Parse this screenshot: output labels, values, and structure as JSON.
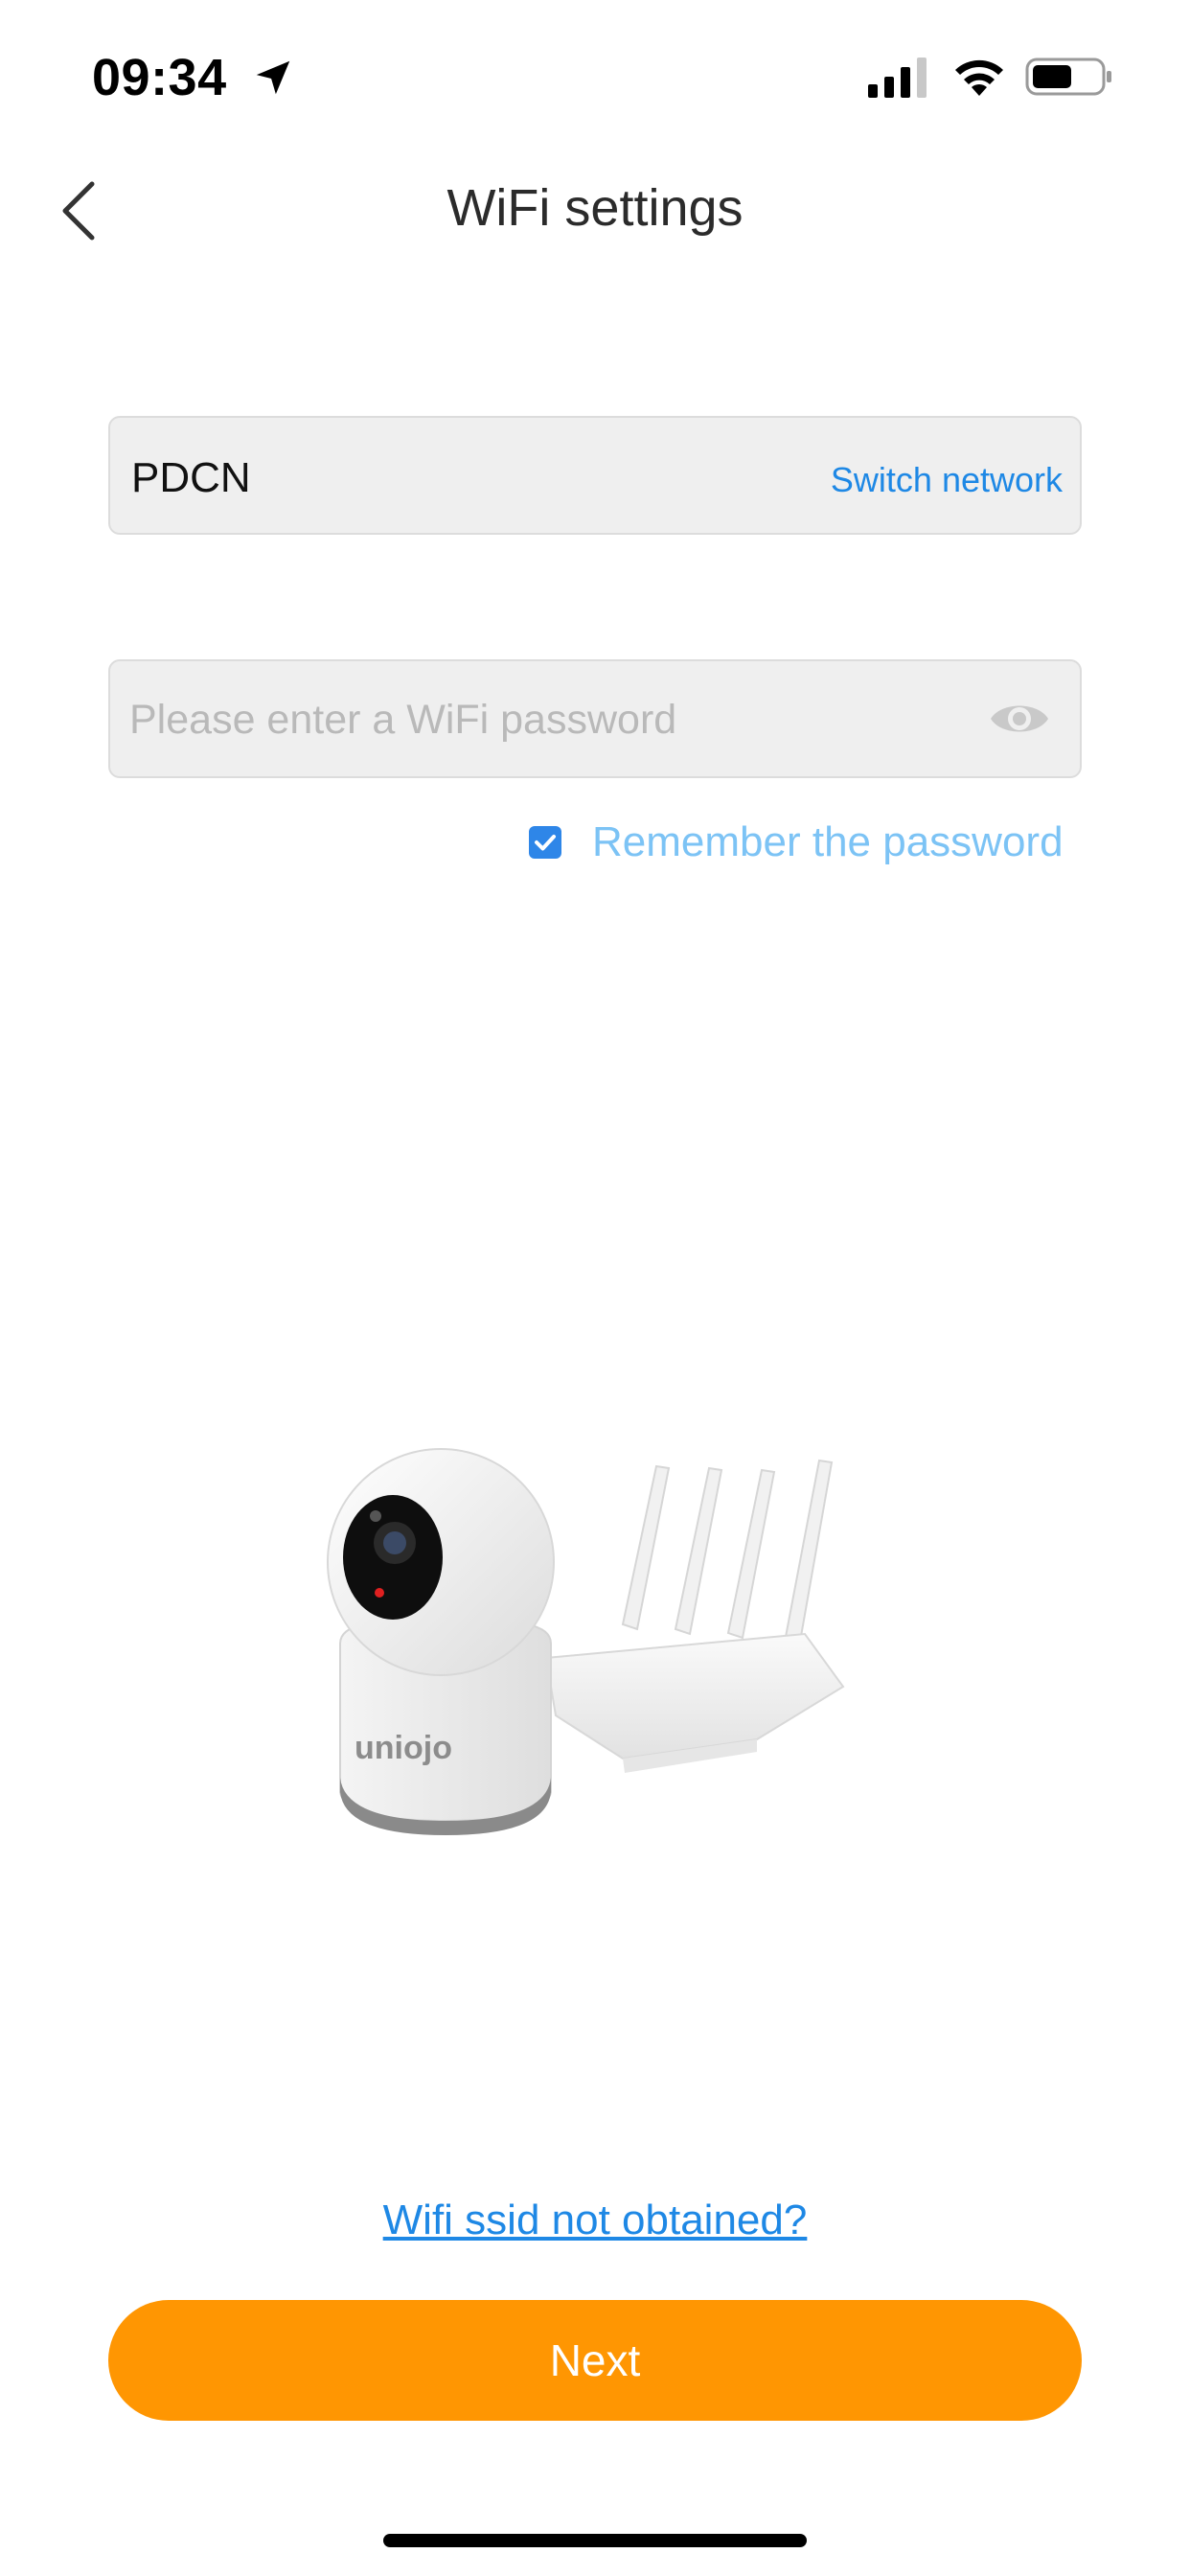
{
  "status_bar": {
    "time": "09:34",
    "icons": [
      "location-arrow-icon",
      "cellular-signal-icon",
      "wifi-icon",
      "battery-icon"
    ]
  },
  "header": {
    "title": "WiFi settings",
    "back_icon": "chevron-left-icon"
  },
  "ssid_field": {
    "value": "PDCN",
    "switch_label": "Switch network"
  },
  "password_field": {
    "value": "",
    "placeholder": "Please enter a WiFi password",
    "visibility_icon": "eye-icon"
  },
  "remember": {
    "checked": true,
    "label": "Remember the password"
  },
  "illustration": {
    "camera_brand": "uniojo"
  },
  "footer": {
    "help_link": "Wifi ssid not obtained?",
    "next_label": "Next"
  },
  "colors": {
    "accent_orange": "#ff9602",
    "link_blue": "#1e88e5",
    "checkbox_blue": "#2e86e8",
    "remember_label": "#7cc3f5",
    "field_bg": "#efefef"
  }
}
